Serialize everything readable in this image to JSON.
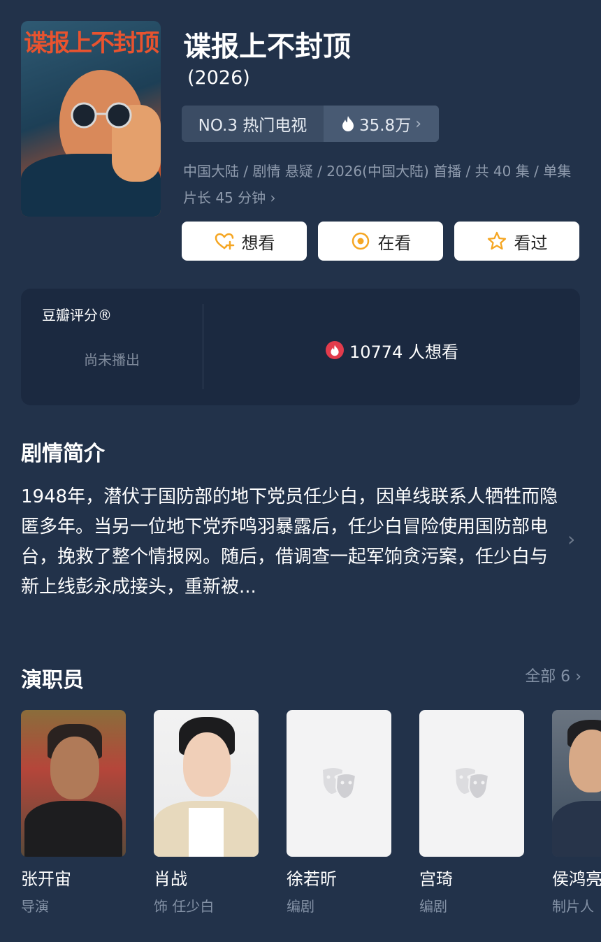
{
  "show": {
    "title": "谍报上不封顶",
    "year": "(2026)",
    "poster_title": "谍报上不封顶"
  },
  "ranking": {
    "label": "NO.3 热门电视",
    "heat": "35.8万",
    "heat_icon": "flame-icon"
  },
  "meta": {
    "text": "中国大陆 / 剧情 悬疑 / 2026(中国大陆) 首播 / 共 40 集 / 单集片长 45 分钟"
  },
  "actions": [
    {
      "label": "想看",
      "icon": "heart-plus-icon",
      "color": "#f5a623"
    },
    {
      "label": "在看",
      "icon": "target-icon",
      "color": "#f5a623"
    },
    {
      "label": "看过",
      "icon": "star-icon",
      "color": "#f5a623"
    }
  ],
  "rating": {
    "label": "豆瓣评分®",
    "status": "尚未播出",
    "wish_text": "10774 人想看"
  },
  "synopsis": {
    "heading": "剧情简介",
    "text": "1948年，潜伏于国防部的地下党员任少白，因单线联系人牺牲而隐匿多年。当另一位地下党乔鸣羽暴露后，任少白冒险使用国防部电台，挽救了整个情报网。随后，借调查一起军饷贪污案，任少白与新上线彭永成接头，重新被..."
  },
  "cast": {
    "heading": "演职员",
    "all_label": "全部 6",
    "members": [
      {
        "name": "张开宙",
        "role": "导演"
      },
      {
        "name": "肖战",
        "role": "饰 任少白"
      },
      {
        "name": "徐若昕",
        "role": "编剧"
      },
      {
        "name": "宫琦",
        "role": "编剧"
      },
      {
        "name": "侯鸿亮",
        "role": "制片人"
      }
    ]
  },
  "colors": {
    "background": "#22324a",
    "card": "#1b2940",
    "accent": "#f5a623",
    "flame": "#e23b4c"
  }
}
